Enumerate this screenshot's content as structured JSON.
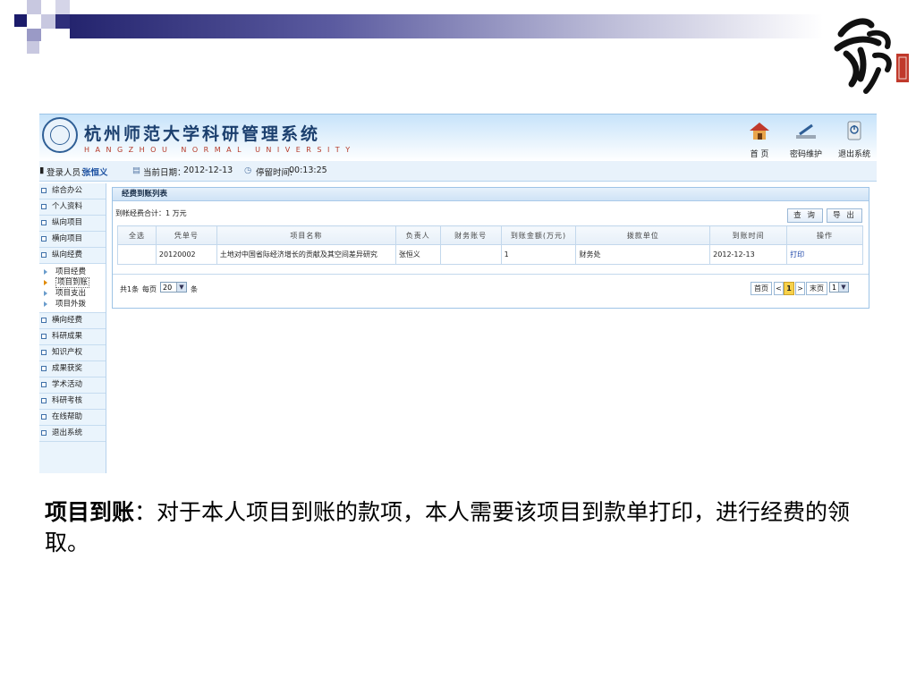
{
  "colors": {
    "deco_navy": "#1c1c6b",
    "accent_blue": "#1a4fa0",
    "page_highlight": "#f7d14a"
  },
  "slide": {
    "caption_bold": "项目到账",
    "caption_rest": "：对于本人项目到账的款项，本人需要该项目到款单打印，进行经费的领取。"
  },
  "app": {
    "title": "杭州师范大学科研管理系统",
    "subtitle": "HANGZHOU NORMAL UNIVERSITY",
    "header_buttons": [
      {
        "label": "首 页",
        "icon": "home-icon"
      },
      {
        "label": "密码维护",
        "icon": "pen-icon"
      },
      {
        "label": "退出系统",
        "icon": "power-icon"
      }
    ],
    "info": {
      "login_label": "登录人员：",
      "login_user": "张恒义",
      "date_label": "当前日期：",
      "date_value": "2012-12-13",
      "stay_label": "停留时间:",
      "stay_value": "00:13:25"
    },
    "sidebar": {
      "items_top": [
        "综合办公",
        "个人资料",
        "纵向项目",
        "横向项目",
        "纵向经费"
      ],
      "sub_items": [
        "项目经费",
        "项目到账",
        "项目支出",
        "项目外拨"
      ],
      "active_sub_index": 1,
      "items_bottom": [
        "横向经费",
        "科研成果",
        "知识产权",
        "成果获奖",
        "学术活动",
        "科研考核",
        "在线帮助",
        "退出系统"
      ]
    },
    "panel": {
      "title": "经费到账列表",
      "total_text": "到帐经费合计：1 万元",
      "query_button": "查 询",
      "export_button": "导 出",
      "columns": [
        "全选",
        "凭单号",
        "项目名称",
        "负责人",
        "财务账号",
        "到账金额(万元)",
        "拨款单位",
        "到账时间",
        "操作"
      ],
      "rows": [
        {
          "select": "",
          "voucher": "20120002",
          "name": "土地对中国省际经济增长的贡献及其空间差异研究",
          "leader": "张恒义",
          "account": "",
          "amount": "1",
          "unit": "财务处",
          "time": "2012-12-13",
          "action": "打印"
        }
      ],
      "pager": {
        "count_text": "共1条",
        "per_page_label": "每页",
        "per_page_value": "20",
        "per_page_unit": "条",
        "first": "首页",
        "prev": "<",
        "current": "1",
        "next": ">",
        "last": "末页",
        "page_select": "1"
      }
    }
  }
}
